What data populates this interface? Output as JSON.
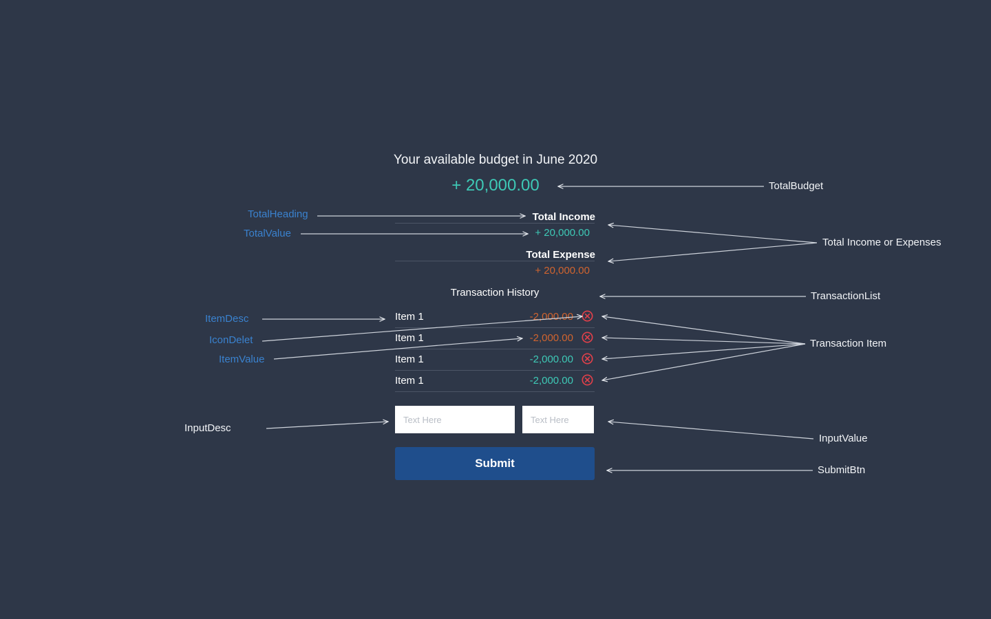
{
  "budget": {
    "title": "Your available budget in June 2020",
    "total": "+ 20,000.00"
  },
  "summary": {
    "income_label": "Total Income",
    "income_value": "+ 20,000.00",
    "expense_label": "Total Expense",
    "expense_value": "+ 20,000.00"
  },
  "history": {
    "title": "Transaction History",
    "items": [
      {
        "desc": "Item 1",
        "value": "-2,000.00",
        "type": "expense"
      },
      {
        "desc": "Item 1",
        "value": "-2,000.00",
        "type": "expense"
      },
      {
        "desc": "Item 1",
        "value": "-2,000.00",
        "type": "income"
      },
      {
        "desc": "Item 1",
        "value": "-2,000.00",
        "type": "income"
      }
    ]
  },
  "form": {
    "desc_placeholder": "Text Here",
    "value_placeholder": "Text Here",
    "submit_label": "Submit"
  },
  "annotations": {
    "total_heading": "TotalHeading",
    "total_value": "TotalValue",
    "item_desc": "ItemDesc",
    "icon_delete": "IconDelet",
    "item_value": "ItemValue",
    "input_desc": "InputDesc",
    "total_budget": "TotalBudget",
    "total_income_or_expenses": "Total Income or Expenses",
    "transaction_list": "TransactionList",
    "transaction_item": "Transaction Item",
    "input_value": "InputValue",
    "submit_btn": "SubmitBtn"
  },
  "colors": {
    "background": "#2e3748",
    "income": "#3ec9b6",
    "expense": "#d0642f",
    "delete_icon": "#e0404a",
    "submit_button": "#1f4e8c",
    "annotation_blue": "#3a82cf"
  },
  "icons": {
    "delete": "close-circle-icon"
  }
}
